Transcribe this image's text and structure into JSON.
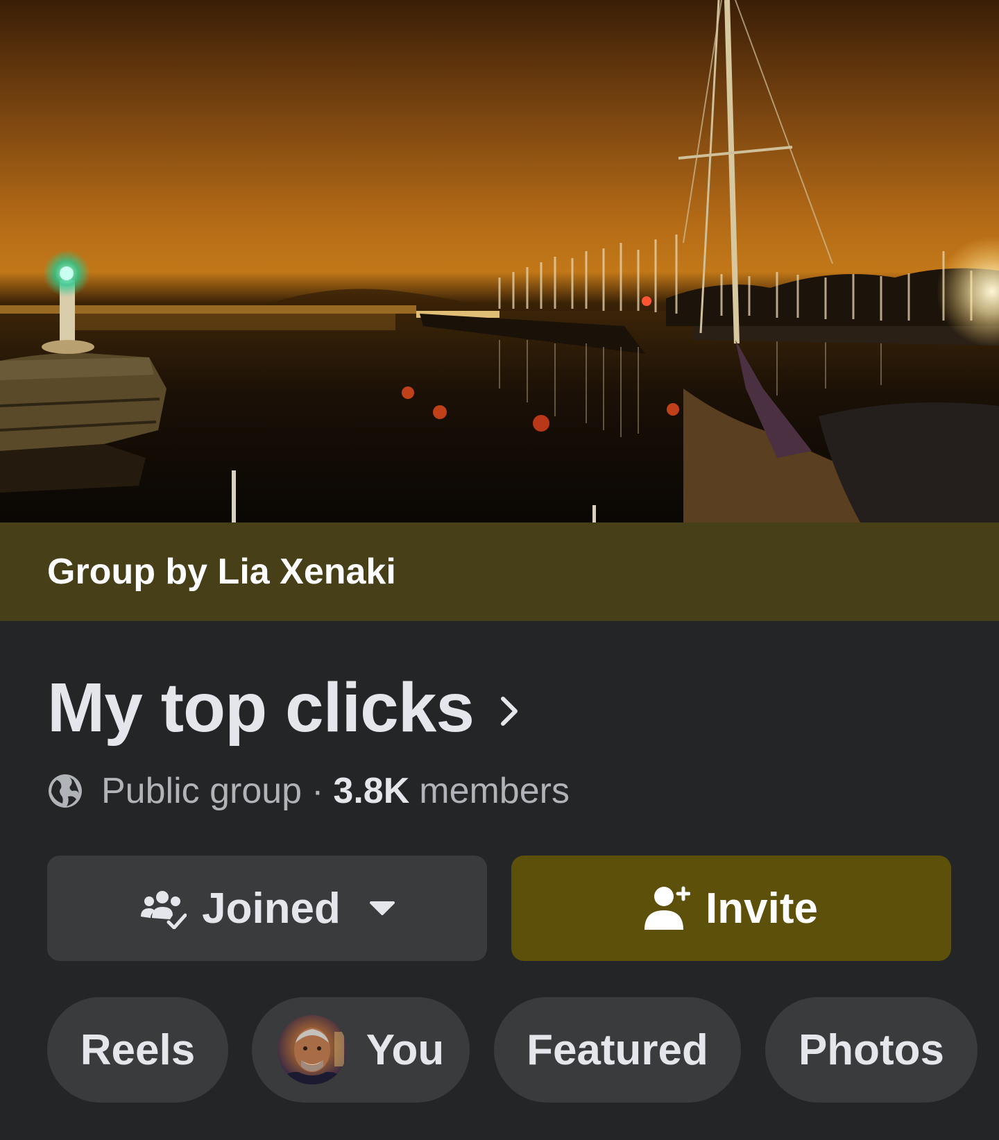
{
  "cover": {
    "banner_text": "Group by Lia Xenaki"
  },
  "group": {
    "title": "My top clicks",
    "privacy": "Public group",
    "separator": "·",
    "member_count": "3.8K",
    "member_label": "members"
  },
  "actions": {
    "joined_label": "Joined",
    "invite_label": "Invite"
  },
  "chips": {
    "reels": "Reels",
    "you": "You",
    "featured": "Featured",
    "photos": "Photos"
  },
  "colors": {
    "page_bg": "#242526",
    "banner_bg": "#473f17",
    "invite_bg": "#5c500b",
    "button_bg": "#3a3b3c",
    "text_primary": "#e4e6eb",
    "text_secondary": "#b0b3b8"
  },
  "icons": {
    "title_chevron": "chevron-right-icon",
    "privacy": "globe-icon",
    "joined": "group-joined-icon",
    "joined_caret": "caret-down-icon",
    "invite": "person-add-icon"
  }
}
